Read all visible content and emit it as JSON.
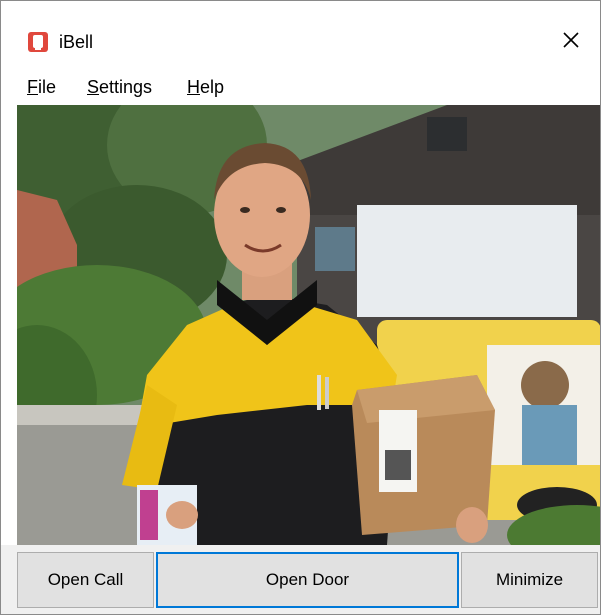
{
  "window": {
    "title": "iBell",
    "app_icon": "bell-app-icon",
    "close_icon": "close-icon"
  },
  "menu": {
    "file": {
      "label": "File",
      "mnemonic": "F",
      "rest": "ile"
    },
    "settings": {
      "label": "Settings",
      "mnemonic": "S",
      "rest": "ettings"
    },
    "help": {
      "label": "Help",
      "mnemonic": "H",
      "rest": "elp"
    }
  },
  "camera": {
    "description_icon": "doorbell-camera-feed"
  },
  "buttons": {
    "open_call": "Open Call",
    "open_door": "Open Door",
    "minimize": "Minimize"
  },
  "colors": {
    "accent": "#0078d7",
    "app_icon": "#e0483d",
    "button_face": "#e1e1e1",
    "button_bar": "#f0f0f0"
  }
}
